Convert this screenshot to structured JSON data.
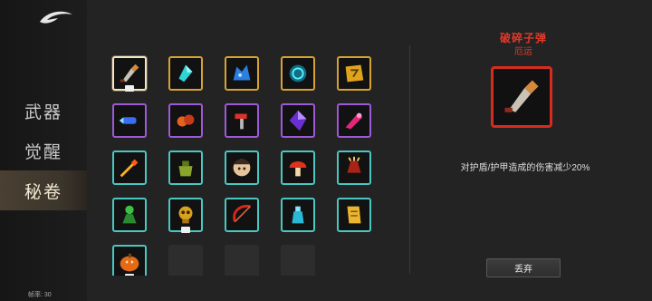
{
  "sidebar": {
    "tabs": [
      {
        "label": "武器"
      },
      {
        "label": "觉醒"
      },
      {
        "label": "秘卷",
        "active": true
      }
    ],
    "fps_label": "帧率: 30"
  },
  "grid": {
    "slots": [
      {
        "icon": "shattered-bullet-icon",
        "rarity": "gold",
        "selected": true,
        "badge": true
      },
      {
        "icon": "cyan-crystal-shard-icon",
        "rarity": "gold"
      },
      {
        "icon": "blue-wolf-spirit-icon",
        "rarity": "gold"
      },
      {
        "icon": "teal-vortex-orb-icon",
        "rarity": "gold"
      },
      {
        "icon": "golden-rune-stone-icon",
        "rarity": "gold"
      },
      {
        "icon": "blue-bullet-burst-icon",
        "rarity": "purple"
      },
      {
        "icon": "orange-orb-pair-icon",
        "rarity": "purple"
      },
      {
        "icon": "red-hammer-icon",
        "rarity": "purple"
      },
      {
        "icon": "purple-crystal-icon",
        "rarity": "purple"
      },
      {
        "icon": "pink-blade-flare-icon",
        "rarity": "purple"
      },
      {
        "icon": "flaming-arrow-icon",
        "rarity": "teal"
      },
      {
        "icon": "green-potion-pot-icon",
        "rarity": "teal"
      },
      {
        "icon": "character-face-icon",
        "rarity": "teal"
      },
      {
        "icon": "red-mushroom-icon",
        "rarity": "teal"
      },
      {
        "icon": "red-claw-gauntlet-icon",
        "rarity": "teal"
      },
      {
        "icon": "green-spirit-figure-icon",
        "rarity": "teal"
      },
      {
        "icon": "golden-skull-totem-icon",
        "rarity": "teal",
        "badge": true
      },
      {
        "icon": "red-bow-slash-icon",
        "rarity": "teal"
      },
      {
        "icon": "cyan-potion-bottle-icon",
        "rarity": "teal"
      },
      {
        "icon": "golden-scroll-icon",
        "rarity": "teal"
      },
      {
        "icon": "pumpkin-lantern-icon",
        "rarity": "teal",
        "badge": true
      },
      {
        "icon": "",
        "rarity": "empty"
      },
      {
        "icon": "",
        "rarity": "empty"
      },
      {
        "icon": "",
        "rarity": "empty"
      }
    ]
  },
  "detail": {
    "title": "破碎子弹",
    "subtitle": "厄运",
    "icon": "shattered-bullet-icon",
    "description": "对护盾/护甲造成的伤害减少20%",
    "discard_label": "丢弃"
  },
  "colors": {
    "gold": "#d7a233",
    "purple": "#9d59d6",
    "teal": "#49c7c0",
    "accent_red": "#e23a2a",
    "active_tab": "#4a4032"
  }
}
